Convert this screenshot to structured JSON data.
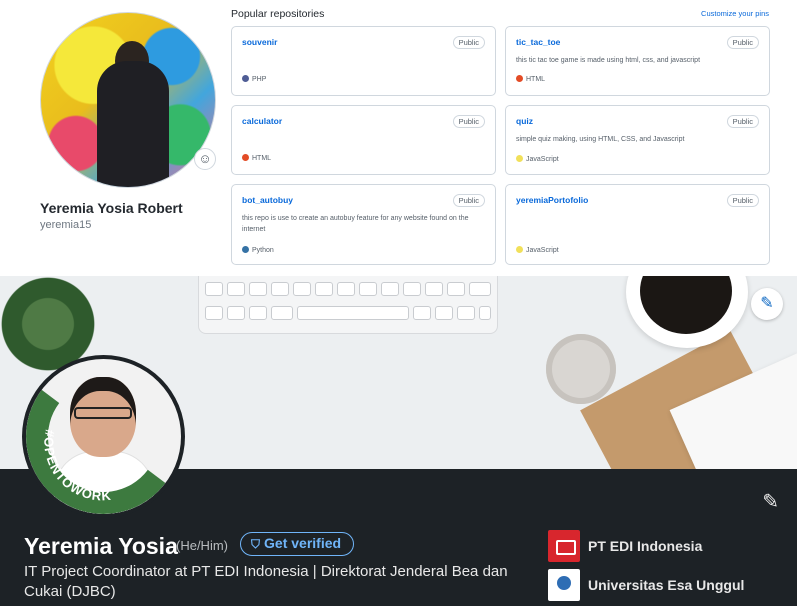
{
  "github": {
    "display_name": "Yeremia Yosia Robert",
    "login": "yeremia15",
    "status_icon": "smiley-icon",
    "section_title": "Popular repositories",
    "customize_label": "Customize your pins",
    "repos": [
      {
        "name": "souvenir",
        "visibility": "Public",
        "description": "",
        "language": "PHP",
        "language_color": "#4F5D95"
      },
      {
        "name": "tic_tac_toe",
        "visibility": "Public",
        "description": "this tic tac toe game is made using html, css, and javascript",
        "language": "HTML",
        "language_color": "#e34c26"
      },
      {
        "name": "calculator",
        "visibility": "Public",
        "description": "",
        "language": "HTML",
        "language_color": "#e34c26"
      },
      {
        "name": "quiz",
        "visibility": "Public",
        "description": "simple quiz making, using HTML, CSS, and Javascript",
        "language": "JavaScript",
        "language_color": "#f1e05a"
      },
      {
        "name": "bot_autobuy",
        "visibility": "Public",
        "description": "this repo is use to create an autobuy feature for any website found on the internet",
        "language": "Python",
        "language_color": "#3572A5"
      },
      {
        "name": "yeremiaPortofolio",
        "visibility": "Public",
        "description": "",
        "language": "JavaScript",
        "language_color": "#f1e05a"
      }
    ]
  },
  "linkedin": {
    "name": "Yeremia Yosia",
    "pronouns": "(He/Him)",
    "verify_label": "Get verified",
    "headline": "IT Project Coordinator at PT EDI Indonesia | Direktorat Jenderal Bea dan Cukai (DJBC)",
    "open_to_work": "#OPENTOWORK",
    "edit_cover_icon": "pencil-icon",
    "edit_profile_icon": "pencil-icon",
    "experience": [
      {
        "label": "PT EDI Indonesia",
        "logo": "edi-logo"
      },
      {
        "label": "Universitas Esa Unggul",
        "logo": "esa-unggul-logo"
      }
    ],
    "accent_color": "#70b5f9",
    "otw_color": "#3d7a3f"
  }
}
